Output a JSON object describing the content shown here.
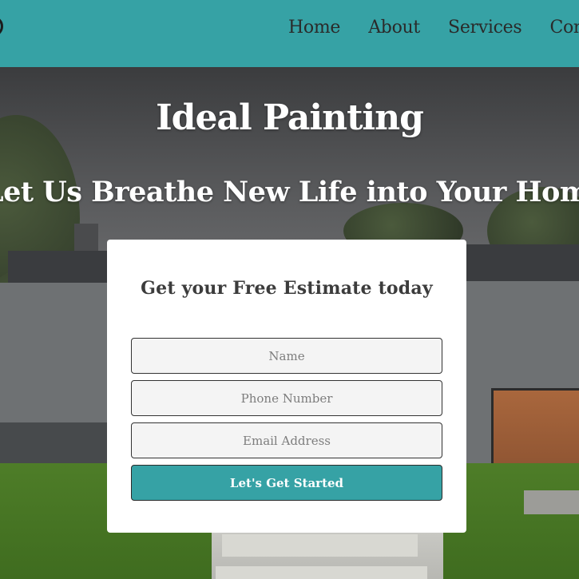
{
  "nav": {
    "links": [
      {
        "label": "Home"
      },
      {
        "label": "About"
      },
      {
        "label": "Services"
      },
      {
        "label": "Conta"
      }
    ]
  },
  "hero": {
    "title": "Ideal Painting",
    "subtitle": "Let Us Breathe New Life into Your Home"
  },
  "form": {
    "title": "Get your Free Estimate today",
    "name_placeholder": "Name",
    "phone_placeholder": "Phone Number",
    "email_placeholder": "Email Address",
    "submit_label": "Let's Get Started"
  },
  "colors": {
    "accent": "#36a2a5",
    "nav_text": "#2a2a2a",
    "card_bg": "#ffffff"
  }
}
